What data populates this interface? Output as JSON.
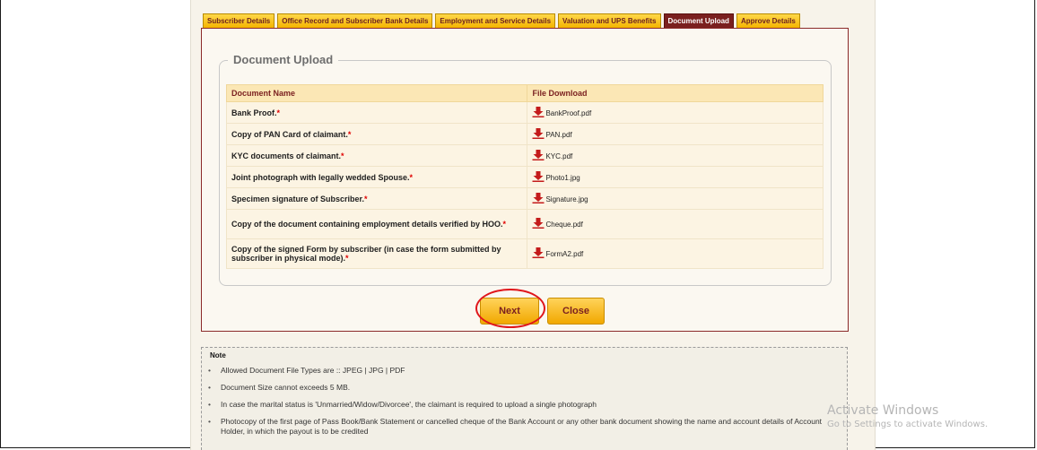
{
  "tabs": [
    {
      "label": "Subscriber Details",
      "active": false
    },
    {
      "label": "Office Record and Subscriber Bank Details",
      "active": false
    },
    {
      "label": "Employment and Service Details",
      "active": false
    },
    {
      "label": "Valuation and UPS Benefits",
      "active": false
    },
    {
      "label": "Document Upload",
      "active": true
    },
    {
      "label": "Approve Details",
      "active": false
    }
  ],
  "section": {
    "title": "Document Upload",
    "columns": [
      "Document Name",
      "File Download"
    ],
    "rows": [
      {
        "name": "Bank Proof.",
        "required": "*",
        "file": "BankProof.pdf"
      },
      {
        "name": "Copy of PAN Card of claimant.",
        "required": "*",
        "file": "PAN.pdf"
      },
      {
        "name": "KYC documents of claimant.",
        "required": "*",
        "file": "KYC.pdf"
      },
      {
        "name": "Joint photograph with legally wedded Spouse.",
        "required": "*",
        "file": "Photo1.jpg"
      },
      {
        "name": "Specimen signature of Subscriber.",
        "required": "*",
        "file": "Signature.jpg"
      },
      {
        "name": "Copy of the document containing employment details verified by HOO.",
        "required": "*",
        "file": "Cheque.pdf"
      },
      {
        "name": "Copy of the signed Form by subscriber (in case the form submitted by subscriber in physical mode).",
        "required": "*",
        "file": "FormA2.pdf"
      }
    ]
  },
  "buttons": {
    "next": "Next",
    "close": "Close"
  },
  "note": {
    "title": "Note",
    "items": [
      "Allowed Document File Types are :: JPEG | JPG | PDF",
      "Document Size cannot exceeds 5 MB.",
      "In case the marital status is 'Unmarried/Widow/Divorcee', the claimant is required to upload a single photograph",
      "Photocopy of the first page of Pass Book/Bank Statement or cancelled cheque of the Bank Account or any other bank document showing the name and account details of Account Holder, in which the payout is to be credited"
    ]
  },
  "watermark": {
    "line1": "Activate Windows",
    "line2": "Go to Settings to activate Windows."
  },
  "colors": {
    "accent": "#7a1f1f",
    "button": "#f4b400",
    "highlight": "#e0161b"
  }
}
